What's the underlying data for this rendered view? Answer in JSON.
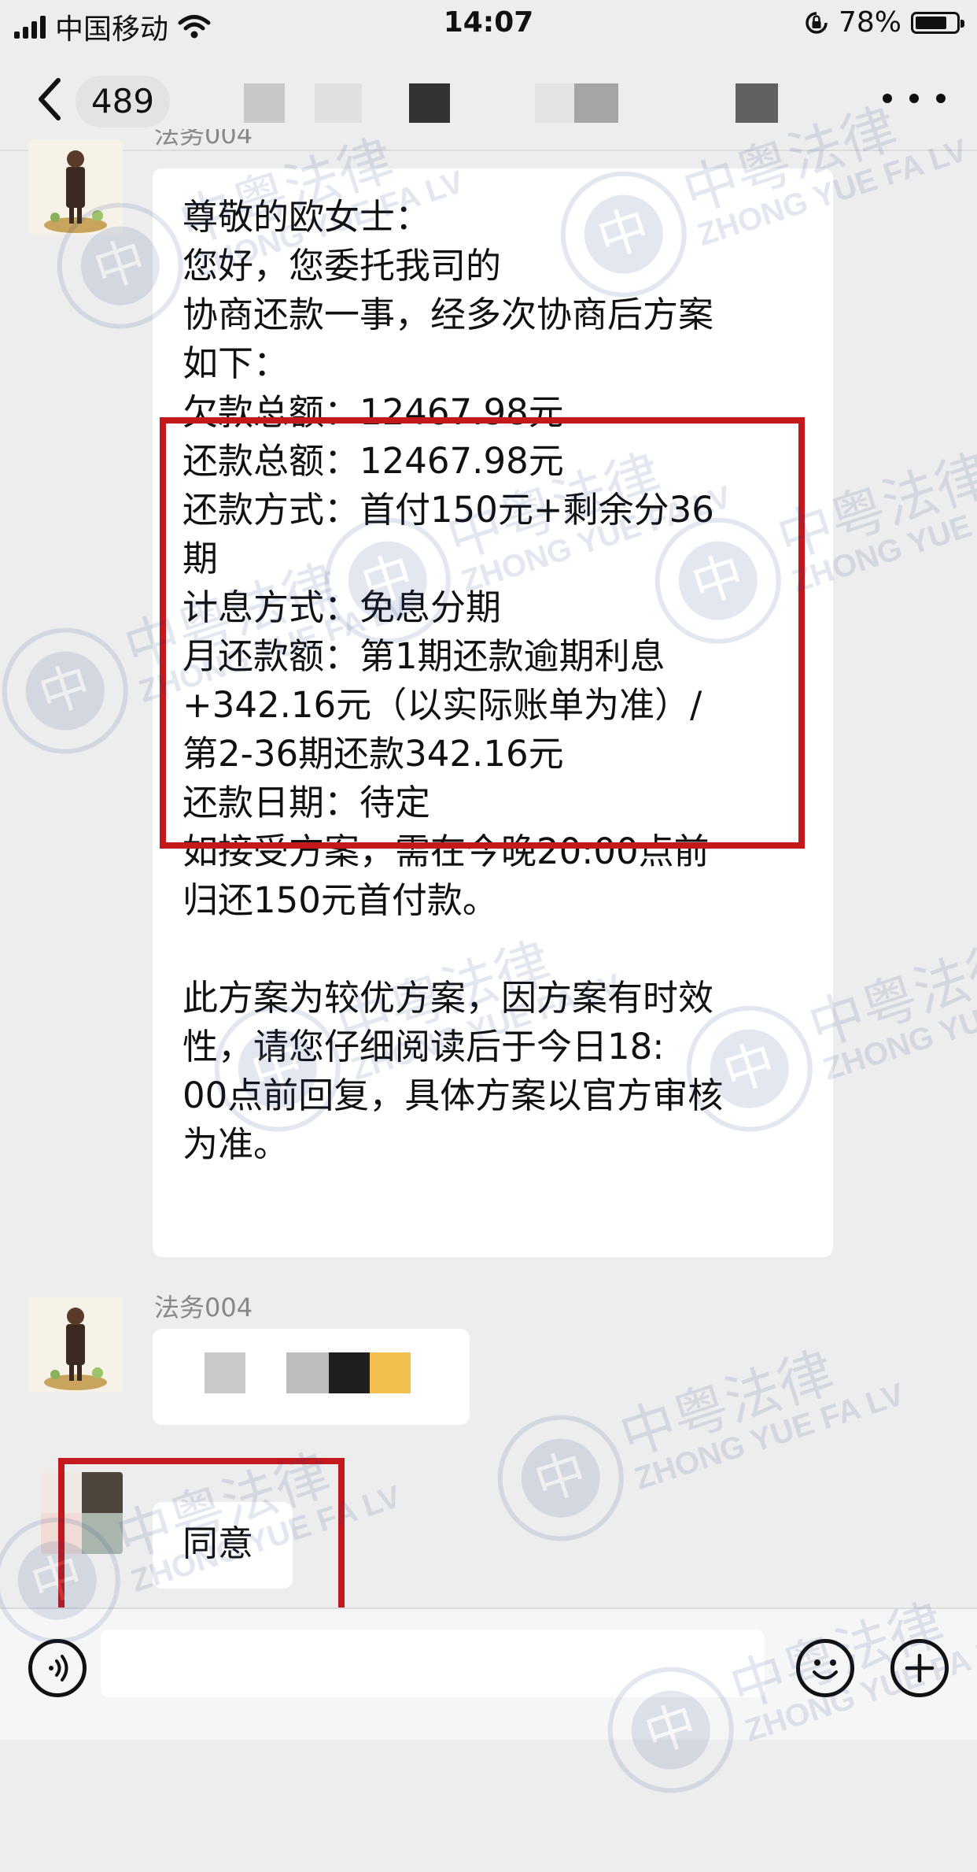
{
  "status_bar": {
    "carrier": "中国移动",
    "time": "14:07",
    "battery_text": "78%",
    "battery_level": 0.78,
    "icons": [
      "signal-icon",
      "wifi-icon",
      "orientation-lock-icon",
      "battery-icon"
    ]
  },
  "nav": {
    "back_icon": "chevron-left-icon",
    "unread_count": "489",
    "more_icon": "more-dots-icon"
  },
  "messages": {
    "first_sender_partial": "法务004",
    "first_message_lines": [
      "尊敬的欧女士：",
      "您好，您委托我司的",
      "协商还款一事，经多次协商后方案",
      "如下：",
      "欠款总额：12467.98元",
      "还款总额：12467.98元",
      "还款方式：首付150元+剩余分36",
      "期",
      "计息方式：免息分期",
      "月还款额：第1期还款逾期利息",
      "+342.16元（以实际账单为准）/",
      "第2-36期还款342.16元",
      "还款日期：待定",
      "如接受方案，需在今晚20:00点前",
      "归还150元首付款。",
      "",
      "此方案为较优方案，因方案有时效",
      "性，请您仔细阅读后于今日18:",
      "00点前回复，具体方案以官方审核",
      "为准。"
    ],
    "second_sender": "法务004",
    "reply_text": "同意"
  },
  "watermark": {
    "cn": "中粤法律",
    "en": "ZHONG YUE FA LV",
    "logo_char": "中"
  },
  "input_bar": {
    "voice_icon": "voice-icon",
    "emoji_icon": "emoji-icon",
    "plus_icon": "plus-icon"
  },
  "colors": {
    "highlight_box": "#c4191c",
    "background": "#ededed",
    "bubble": "#ffffff"
  }
}
